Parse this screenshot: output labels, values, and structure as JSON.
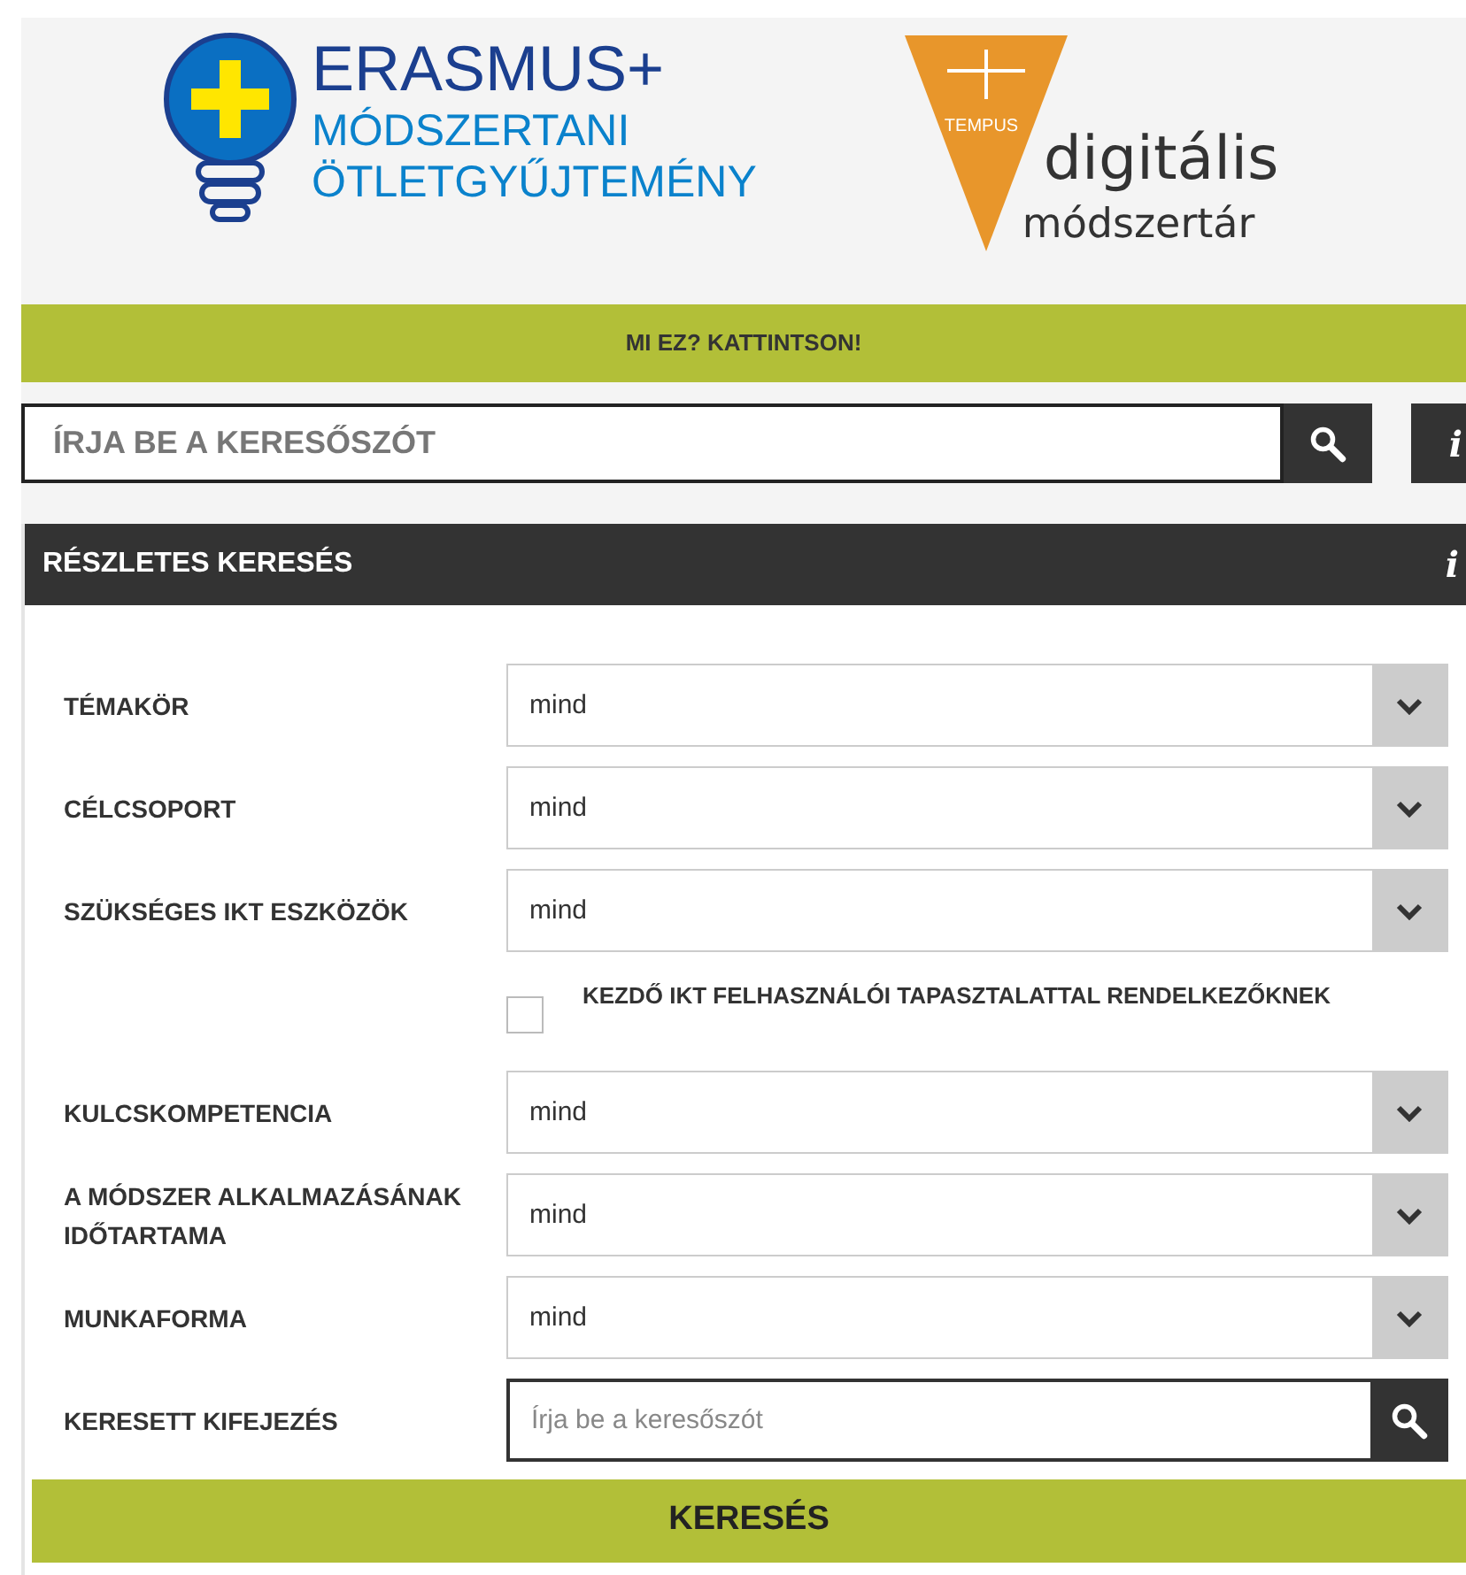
{
  "header": {
    "erasmus_logo": {
      "title": "ERASMUS+",
      "subtitle_lines": [
        "MÓDSZERTANI",
        "ÖTLETGYŰJTEMÉNY"
      ]
    },
    "tempus_logo": {
      "badge": "TEMPUS",
      "lines": [
        "digitális",
        "módszertár"
      ]
    }
  },
  "info_bar": {
    "label": "MI EZ? KATTINTSON!"
  },
  "search": {
    "placeholder": "ÍRJA BE A KERESŐSZÓT",
    "info": "i"
  },
  "detailed_search": {
    "title": "RÉSZLETES KERESÉS",
    "info": "i",
    "fields": [
      {
        "kind": "select",
        "label": "TÉMAKÖR",
        "value": "mind"
      },
      {
        "kind": "select",
        "label": "CÉLCSOPORT",
        "value": "mind"
      },
      {
        "kind": "select",
        "label": "SZÜKSÉGES IKT ESZKÖZÖK",
        "value": "mind"
      },
      {
        "kind": "checkbox",
        "label": "KEZDŐ IKT FELHASZNÁLÓI TAPASZTALATTAL RENDELKEZŐKNEK",
        "checked": false
      },
      {
        "kind": "select",
        "label": "KULCSKOMPETENCIA",
        "value": "mind"
      },
      {
        "kind": "select",
        "label": "A MÓDSZER ALKALMAZÁSÁNAK IDŐTARTAMA",
        "value": "mind"
      },
      {
        "kind": "select",
        "label": "MUNKAFORMA",
        "value": "mind"
      },
      {
        "kind": "text",
        "label": "KERESETT KIFEJEZÉS",
        "placeholder": "Írja be a keresőszót"
      }
    ],
    "submit": "KERESÉS"
  }
}
